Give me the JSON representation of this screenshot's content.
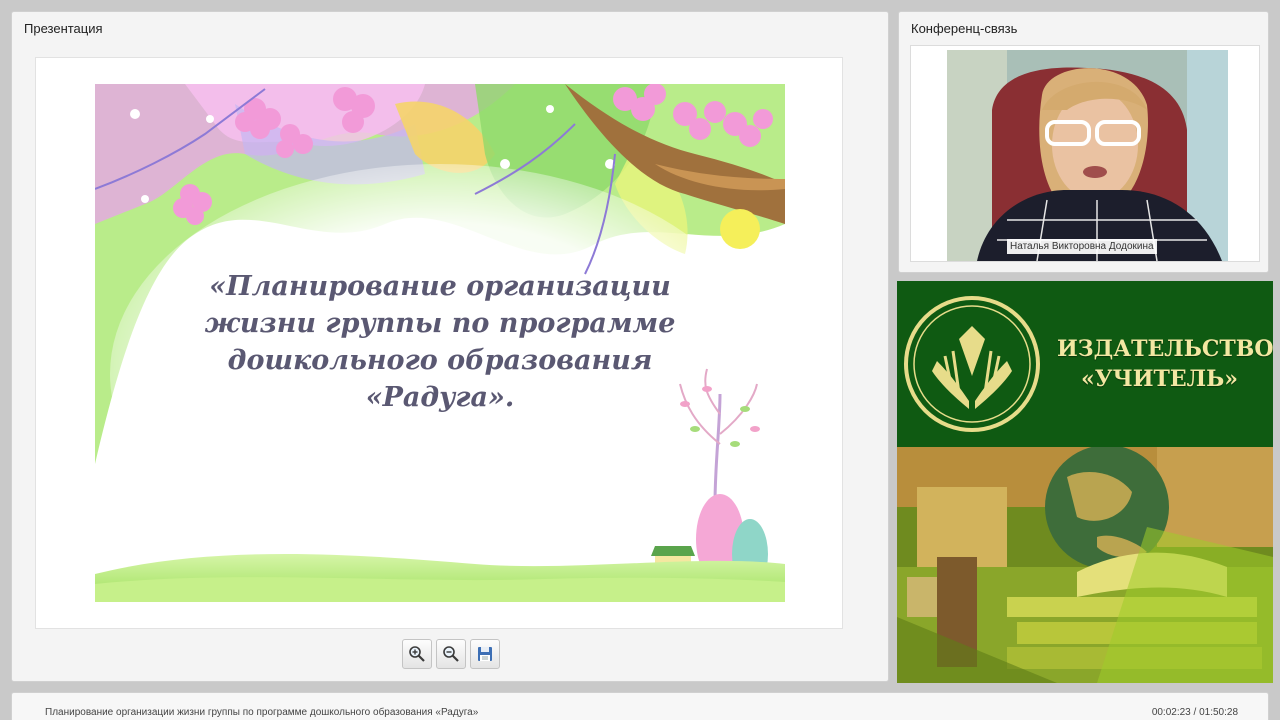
{
  "presentation_panel": {
    "title": "Презентация",
    "slide_title": "«Планирование организации жизни группы по программе дошкольного образования «Радуга».",
    "toolbar": {
      "zoom_in_icon": "zoom-in-icon",
      "zoom_out_icon": "zoom-out-icon",
      "save_icon": "save-icon"
    }
  },
  "conference_panel": {
    "title": "Конференц-связь",
    "speaker_name": "Наталья Викторовна Додокина"
  },
  "publisher_banner": {
    "name": "ИЗДАТЕЛЬСТВО «УЧИТЕЛЬ»",
    "brand_color": "#0f5a12",
    "text_color": "#f3e7a2"
  },
  "footer": {
    "title": "Планирование организации жизни группы по программе дошкольного образования «Радуга»",
    "time": "00:02:23 / 01:50:28"
  }
}
